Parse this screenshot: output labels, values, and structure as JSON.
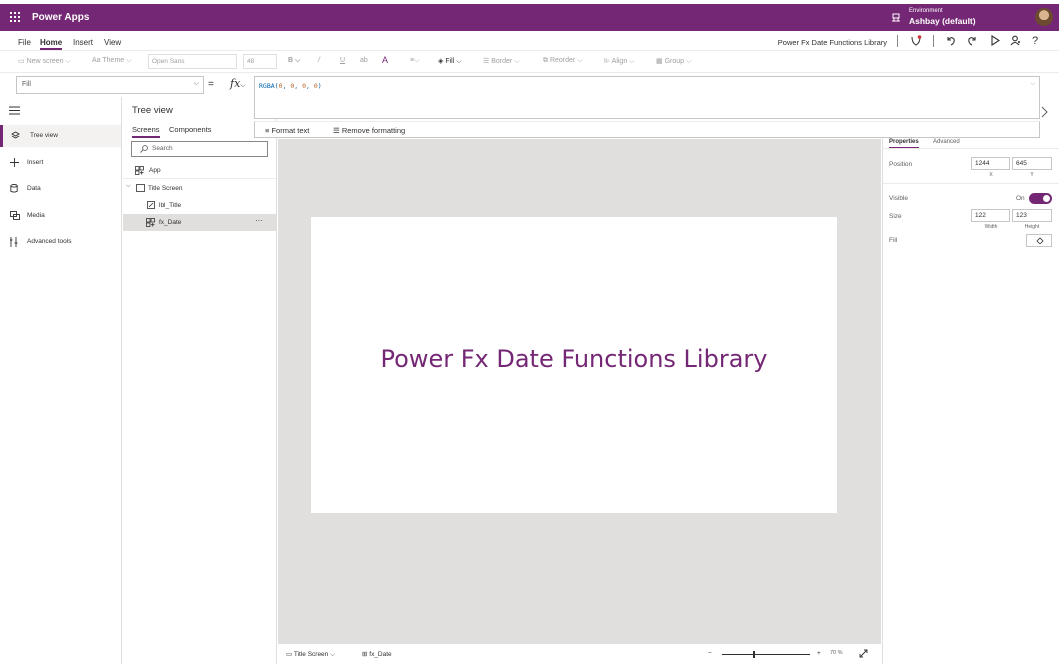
{
  "topbar": {
    "app_name": "Power Apps",
    "env_label": "Environment",
    "env_name": "Ashbay (default)"
  },
  "menu": {
    "file": "File",
    "home": "Home",
    "insert": "Insert",
    "view": "View",
    "doc_title": "Power Fx Date Functions Library"
  },
  "ribbon": {
    "new_screen": "New screen",
    "theme": "Theme",
    "font": "Open Sans",
    "font_size": "48",
    "fill": "Fill",
    "border": "Border",
    "reorder": "Reorder",
    "align": "Align",
    "group": "Group"
  },
  "formula": {
    "property": "Fill",
    "prefix": "RGBA(",
    "n1": "0",
    "n2": "0",
    "n3": "0",
    "n4": "0",
    "suffix": ")",
    "format_text": "Format text",
    "remove_formatting": "Remove formatting"
  },
  "leftrail": {
    "tree_view": "Tree view",
    "insert": "Insert",
    "data": "Data",
    "media": "Media",
    "advanced_tools": "Advanced tools"
  },
  "tree": {
    "title": "Tree view",
    "tab_screens": "Screens",
    "tab_components": "Components",
    "search_placeholder": "Search",
    "app": "App",
    "screen": "Title Screen",
    "label": "lbl_Title",
    "control": "fx_Date",
    "more": "···"
  },
  "canvas": {
    "title_text": "Power Fx Date Functions Library"
  },
  "bottombar": {
    "screen": "Title Screen",
    "control": "fx_Date",
    "minus": "−",
    "plus": "+",
    "zoom": "70 %"
  },
  "properties": {
    "tab_properties": "Properties",
    "tab_advanced": "Advanced",
    "position_label": "Position",
    "x": "1244",
    "y": "645",
    "x_sub": "X",
    "y_sub": "Y",
    "visible_label": "Visible",
    "visible_value": "On",
    "size_label": "Size",
    "width": "122",
    "height": "123",
    "width_sub": "Width",
    "height_sub": "Height",
    "fill_label": "Fill"
  },
  "colors": {
    "brand": "#742774",
    "canvas": "#e1dfdd",
    "formula_fn": "#0063b1",
    "formula_num": "#b5652d"
  }
}
